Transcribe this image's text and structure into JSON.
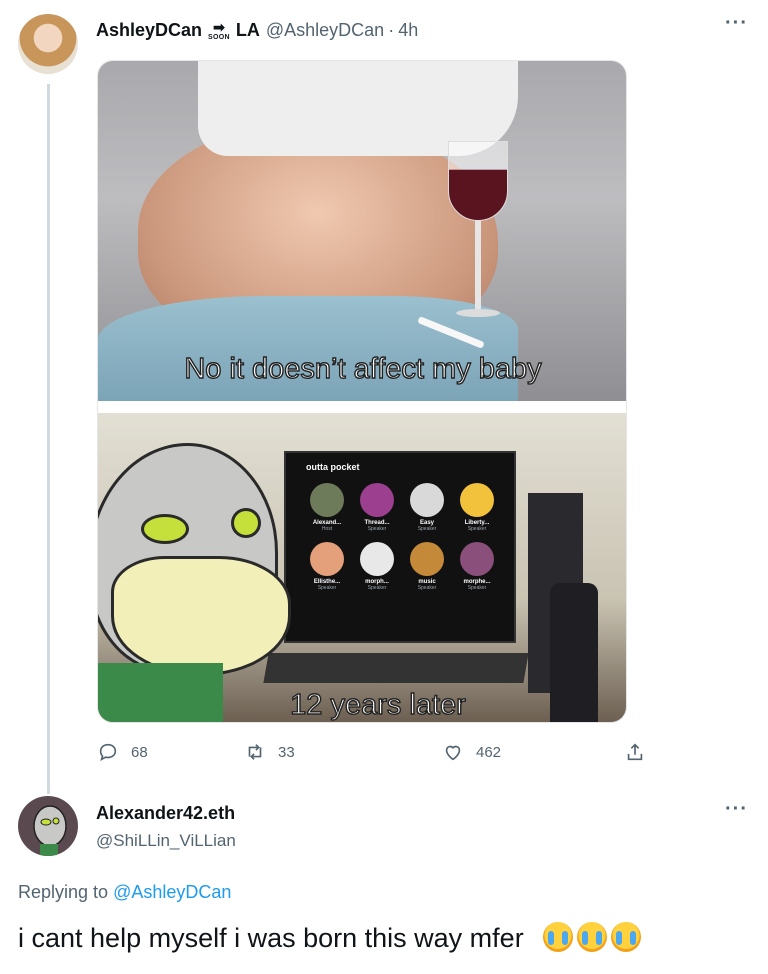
{
  "tweet1": {
    "display_name_part1": "AshleyDCan",
    "soon_arrow": "➡",
    "soon_label": "SOON",
    "display_name_part2": "LA",
    "handle": "@AshleyDCan",
    "separator": "·",
    "time": "4h",
    "more": "···",
    "meme": {
      "caption_top": "No it doesn’t affect my baby",
      "caption_bottom": "12 years later",
      "screen_title": "outta pocket",
      "speakers": [
        {
          "name": "Alexand...",
          "role": "Host",
          "color": "#6e7b5a"
        },
        {
          "name": "Thread...",
          "role": "Speaker",
          "color": "#9b3f8e"
        },
        {
          "name": "Easy",
          "role": "Speaker",
          "color": "#d9d9d9"
        },
        {
          "name": "Liberty...",
          "role": "Speaker",
          "color": "#f3c23c"
        },
        {
          "name": "Ellisthe...",
          "role": "Speaker",
          "color": "#e3a07a"
        },
        {
          "name": "morph...",
          "role": "Speaker",
          "color": "#e8e8e8"
        },
        {
          "name": "music",
          "role": "Speaker",
          "color": "#c48a3a"
        },
        {
          "name": "morphe...",
          "role": "Speaker",
          "color": "#8a4f7a"
        }
      ]
    },
    "actions": {
      "replies": "68",
      "retweets": "33",
      "likes": "462"
    }
  },
  "tweet2": {
    "display_name": "Alexander42.eth",
    "handle": "@ShiLLin_ViLLian",
    "more": "···",
    "replying_prefix": "Replying to",
    "replying_handle": "@AshleyDCan",
    "text": "i cant help myself i was born this way mfer",
    "emoji_name": "loudly-crying-face",
    "emoji_count": 3
  },
  "colors": {
    "accent_link": "#1d9bf0",
    "secondary_text": "#536471",
    "thread_line": "#cfd9de"
  }
}
